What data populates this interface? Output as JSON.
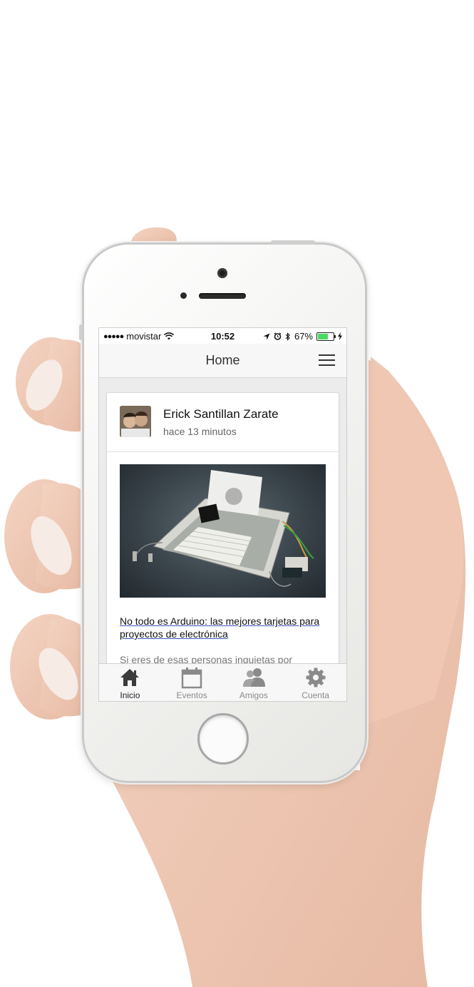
{
  "statusbar": {
    "signal_dots": "●●●●●",
    "carrier": "movistar",
    "time": "10:52",
    "battery_percent": "67%",
    "battery_level": 0.67
  },
  "navbar": {
    "title": "Home",
    "menu_icon": "hamburger-menu-icon"
  },
  "post": {
    "author": "Erick Santillan Zarate",
    "time_ago": "hace 13 minutos",
    "article_title": "No todo es Arduino: las mejores tarjetas para proyectos de electrónica",
    "article_excerpt": "Si eres de esas personas inquietas por"
  },
  "tabbar": {
    "tabs": [
      {
        "label": "Inicio",
        "icon": "home-icon",
        "active": true
      },
      {
        "label": "Eventos",
        "icon": "calendar-icon",
        "active": false
      },
      {
        "label": "Amigos",
        "icon": "friends-icon",
        "active": false
      },
      {
        "label": "Cuenta",
        "icon": "gear-icon",
        "active": false
      }
    ]
  },
  "colors": {
    "battery_green": "#4cd964",
    "link_underline": "#3a55c4",
    "active_tab": "#222222",
    "inactive_tab": "#8a8a8a"
  }
}
